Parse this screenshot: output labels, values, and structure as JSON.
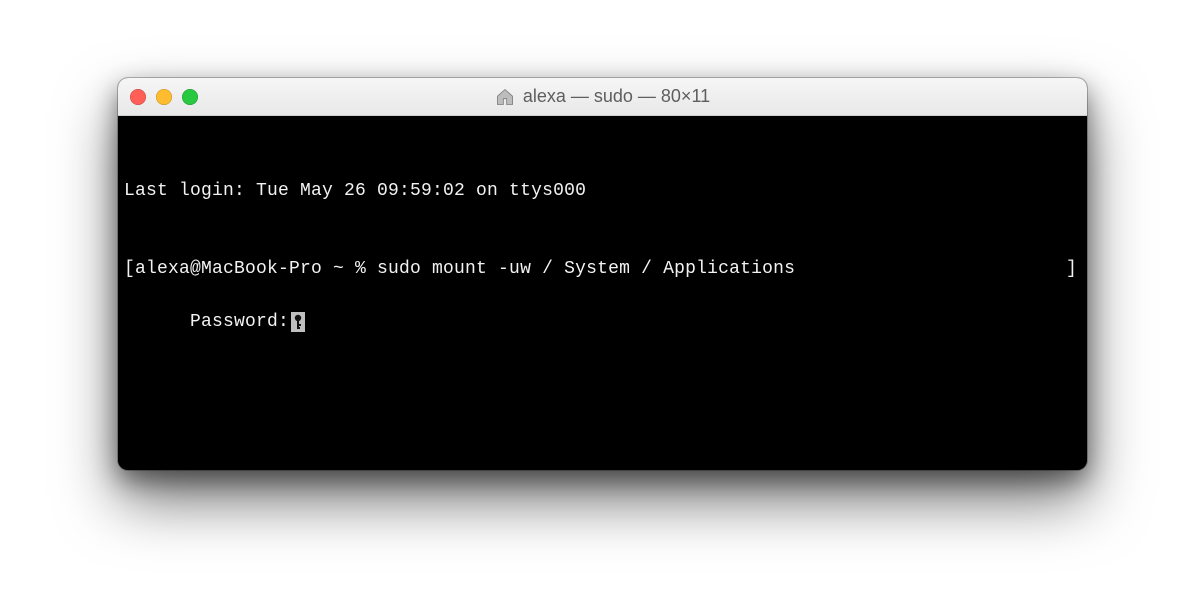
{
  "window": {
    "title": "alexa — sudo — 80×11"
  },
  "terminal": {
    "line1": "Last login: Tue May 26 09:59:02 on ttys000",
    "line2_left": "[alexa@MacBook-Pro ~ % sudo mount -uw / System / Applications",
    "line2_right": "]",
    "password_label": "Password:"
  }
}
